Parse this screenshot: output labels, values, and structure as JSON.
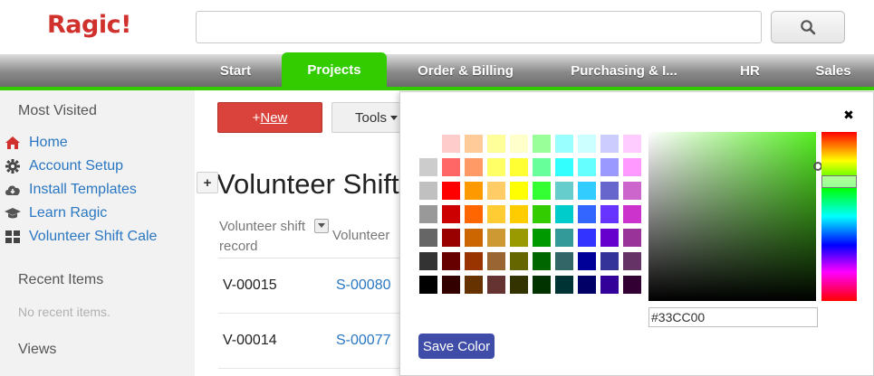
{
  "app": {
    "logo_text": "Ragic!"
  },
  "search": {
    "value": "",
    "placeholder": "",
    "icon": "search-icon"
  },
  "nav": {
    "active_color": "#33cc00",
    "tabs": [
      {
        "label": "Start",
        "active": false
      },
      {
        "label": "Projects",
        "active": true
      },
      {
        "label": "Order & Billing",
        "active": false
      },
      {
        "label": "Purchasing & I...",
        "active": false
      },
      {
        "label": "HR",
        "active": false
      },
      {
        "label": "Sales",
        "active": false
      }
    ]
  },
  "sidebar": {
    "most_visited_heading": "Most Visited",
    "items": [
      {
        "label": "Home",
        "icon": "home-icon"
      },
      {
        "label": "Account Setup",
        "icon": "gear-icon"
      },
      {
        "label": "Install Templates",
        "icon": "cloud-download-icon"
      },
      {
        "label": "Learn Ragic",
        "icon": "graduation-cap-icon"
      },
      {
        "label": "Volunteer Shift Cale",
        "icon": "grid-icon"
      }
    ],
    "recent_heading": "Recent Items",
    "recent_empty": "No recent items.",
    "views_heading": "Views"
  },
  "toolbar": {
    "new_plus": "+",
    "new_label": "New",
    "tools_label": "Tools"
  },
  "page": {
    "title": "Volunteer Shift"
  },
  "table": {
    "columns": [
      "Volunteer shift record",
      "Volunteer"
    ],
    "rows": [
      {
        "id": "V-00015",
        "link": "S-00080"
      },
      {
        "id": "V-00014",
        "link": "S-00077"
      }
    ],
    "add_column_label": "+"
  },
  "color_picker": {
    "close_label": "✖",
    "hex_value": "#33CC00",
    "save_label": "Save Color",
    "hue_color": "#55ee22",
    "swatches": [
      "#ffffff",
      "#ffcccc",
      "#ffcc99",
      "#ffff99",
      "#ffffcc",
      "#99ff99",
      "#99ffff",
      "#ccffff",
      "#ccccff",
      "#ffccff",
      "#cccccc",
      "#ff6666",
      "#ff9966",
      "#ffff66",
      "#ffff33",
      "#66ff99",
      "#33ffff",
      "#66ffff",
      "#9999ff",
      "#ff99ff",
      "#c0c0c0",
      "#ff0000",
      "#ff9900",
      "#ffcc66",
      "#ffff00",
      "#33ff33",
      "#66cccc",
      "#33ccff",
      "#6666cc",
      "#cc66cc",
      "#999999",
      "#cc0000",
      "#ff6600",
      "#ffcc33",
      "#ffcc00",
      "#33cc00",
      "#00cccc",
      "#3366ff",
      "#6633ff",
      "#cc33cc",
      "#666666",
      "#990000",
      "#cc6600",
      "#cc9933",
      "#999900",
      "#009900",
      "#339999",
      "#3333ff",
      "#6600cc",
      "#993399",
      "#333333",
      "#660000",
      "#993300",
      "#996633",
      "#666600",
      "#006600",
      "#336666",
      "#000099",
      "#333399",
      "#663366",
      "#000000",
      "#330000",
      "#663300",
      "#663333",
      "#333300",
      "#003300",
      "#003333",
      "#000066",
      "#330099",
      "#330033"
    ]
  }
}
